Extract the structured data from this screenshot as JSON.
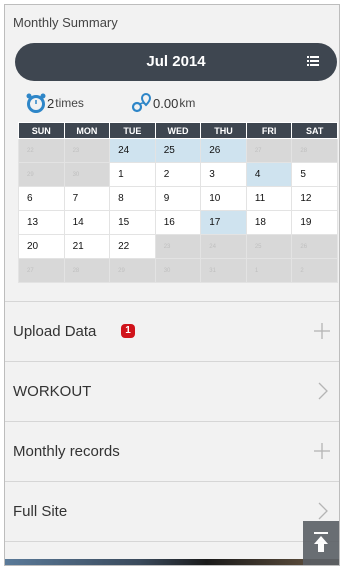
{
  "header": {
    "title": "Monthly Summary"
  },
  "month_bar": {
    "label": "Jul 2014",
    "list_icon": "list-icon"
  },
  "stats": {
    "times_value": "2",
    "times_unit": "times",
    "times_icon": "alarm-clock-icon",
    "distance_value": "0.00",
    "distance_unit": "km",
    "distance_icon": "route-pin-icon",
    "accent": "#2e86c8"
  },
  "calendar": {
    "weekdays": [
      "SUN",
      "MON",
      "TUE",
      "WED",
      "THU",
      "FRI",
      "SAT"
    ],
    "weeks": [
      [
        {
          "d": "22",
          "out": true
        },
        {
          "d": "23",
          "out": true
        },
        {
          "d": "24",
          "hl": true
        },
        {
          "d": "25",
          "hl": true
        },
        {
          "d": "26",
          "hl": true
        },
        {
          "d": "27",
          "out": true
        },
        {
          "d": "28",
          "out": true
        }
      ],
      [
        {
          "d": "29",
          "out": true
        },
        {
          "d": "30",
          "out": true
        },
        {
          "d": "1"
        },
        {
          "d": "2"
        },
        {
          "d": "3"
        },
        {
          "d": "4",
          "hl": true
        },
        {
          "d": "5"
        }
      ],
      [
        {
          "d": "6"
        },
        {
          "d": "7"
        },
        {
          "d": "8"
        },
        {
          "d": "9"
        },
        {
          "d": "10"
        },
        {
          "d": "11"
        },
        {
          "d": "12"
        }
      ],
      [
        {
          "d": "13"
        },
        {
          "d": "14"
        },
        {
          "d": "15"
        },
        {
          "d": "16"
        },
        {
          "d": "17",
          "hl": true
        },
        {
          "d": "18"
        },
        {
          "d": "19"
        }
      ],
      [
        {
          "d": "20"
        },
        {
          "d": "21"
        },
        {
          "d": "22"
        },
        {
          "d": "23",
          "out": true
        },
        {
          "d": "24",
          "out": true
        },
        {
          "d": "25",
          "out": true
        },
        {
          "d": "26",
          "out": true
        }
      ],
      [
        {
          "d": "27",
          "out": true
        },
        {
          "d": "28",
          "out": true
        },
        {
          "d": "29",
          "out": true
        },
        {
          "d": "30",
          "out": true
        },
        {
          "d": "31",
          "out": true
        },
        {
          "d": "1",
          "out": true
        },
        {
          "d": "2",
          "out": true
        }
      ]
    ],
    "highlight_color": "#cfe3ef"
  },
  "menu": {
    "items": [
      {
        "label": "Upload Data",
        "badge": "1",
        "glyph": "plus"
      },
      {
        "label": "WORKOUT",
        "glyph": "chevron"
      },
      {
        "label": "Monthly records",
        "glyph": "plus"
      },
      {
        "label": "Full Site",
        "glyph": "chevron"
      }
    ]
  },
  "scroll_top": {
    "icon": "arrow-up-icon"
  }
}
